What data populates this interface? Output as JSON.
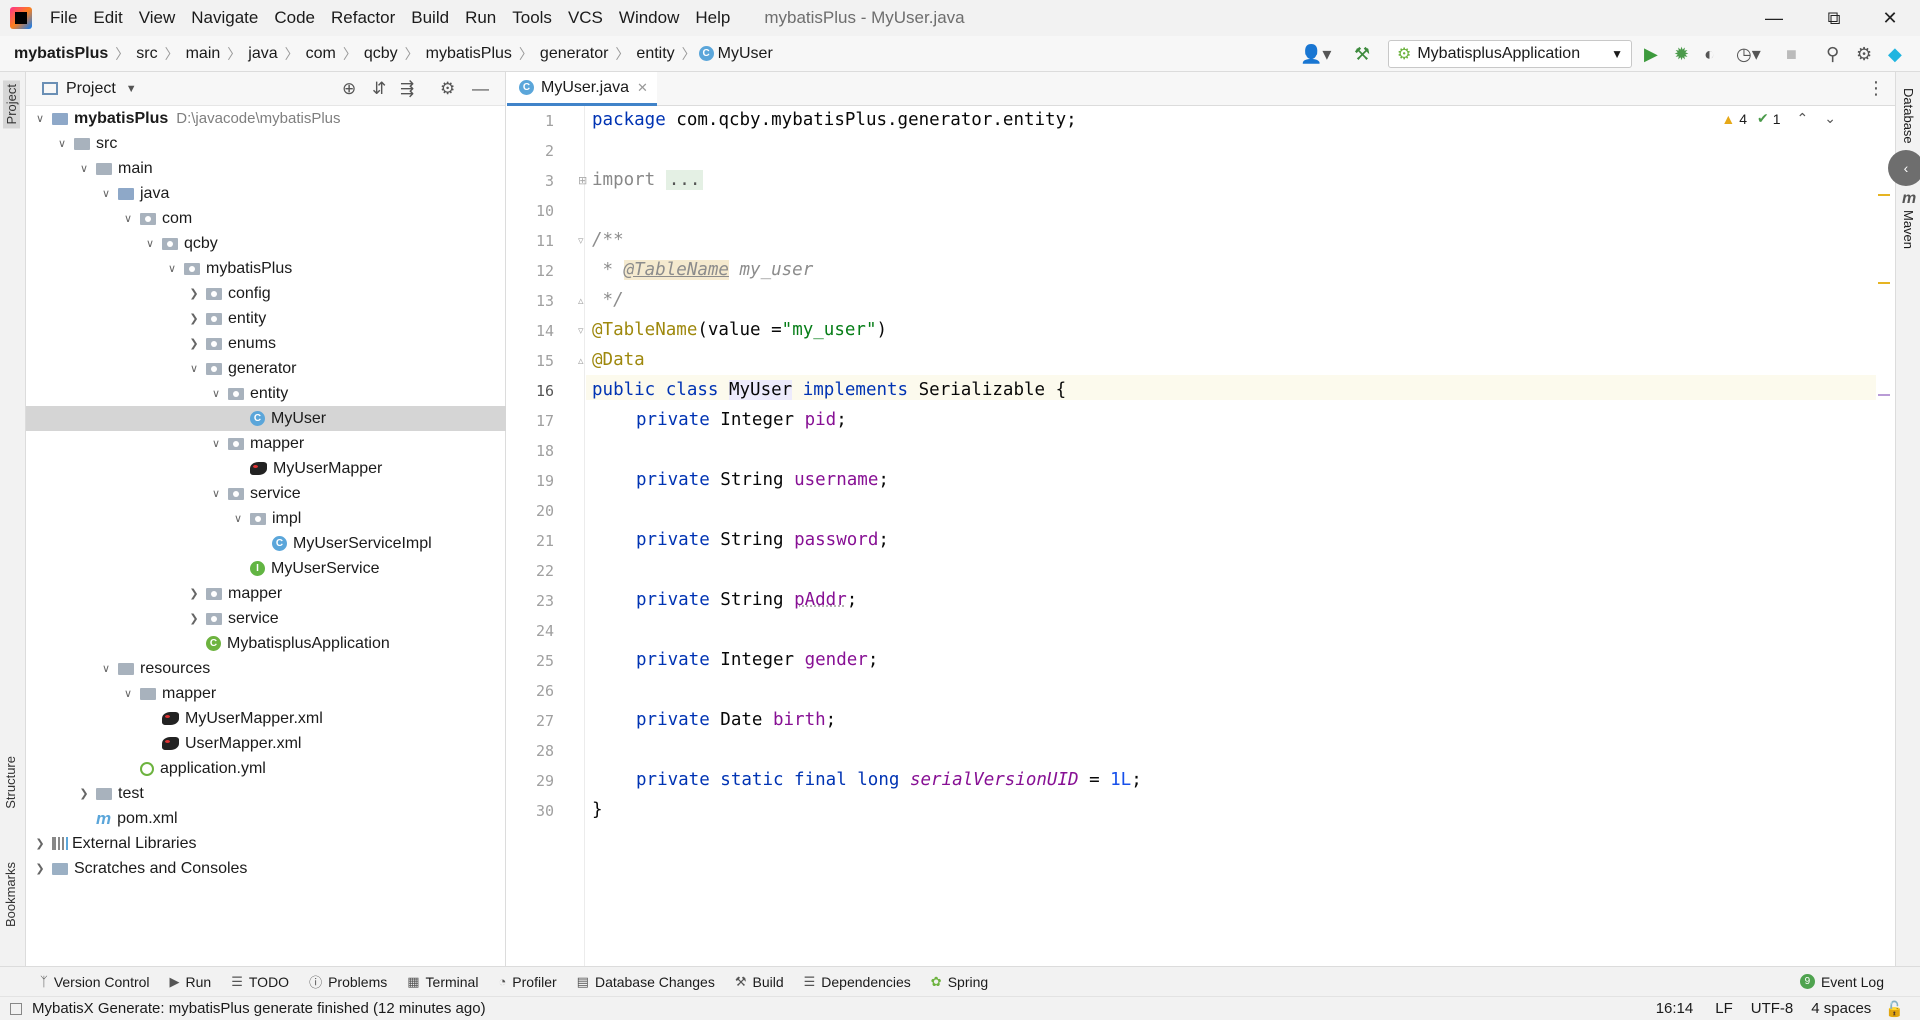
{
  "menu": [
    "File",
    "Edit",
    "View",
    "Navigate",
    "Code",
    "Refactor",
    "Build",
    "Run",
    "Tools",
    "VCS",
    "Window",
    "Help"
  ],
  "window_title": "mybatisPlus - MyUser.java",
  "breadcrumbs": [
    "mybatisPlus",
    "src",
    "main",
    "java",
    "com",
    "qcby",
    "mybatisPlus",
    "generator",
    "entity",
    "MyUser"
  ],
  "run_config": "MybatisplusApplication",
  "project_panel": {
    "title": "Project",
    "root_name": "mybatisPlus",
    "root_path": "D:\\javacode\\mybatisPlus",
    "nodes": [
      {
        "label": "src"
      },
      {
        "label": "main"
      },
      {
        "label": "java"
      },
      {
        "label": "com"
      },
      {
        "label": "qcby"
      },
      {
        "label": "mybatisPlus"
      },
      {
        "label": "config"
      },
      {
        "label": "entity"
      },
      {
        "label": "enums"
      },
      {
        "label": "generator"
      },
      {
        "label": "entity"
      },
      {
        "label": "MyUser"
      },
      {
        "label": "mapper"
      },
      {
        "label": "MyUserMapper"
      },
      {
        "label": "service"
      },
      {
        "label": "impl"
      },
      {
        "label": "MyUserServiceImpl"
      },
      {
        "label": "MyUserService"
      },
      {
        "label": "mapper"
      },
      {
        "label": "service"
      },
      {
        "label": "MybatisplusApplication"
      },
      {
        "label": "resources"
      },
      {
        "label": "mapper"
      },
      {
        "label": "MyUserMapper.xml"
      },
      {
        "label": "UserMapper.xml"
      },
      {
        "label": "application.yml"
      },
      {
        "label": "test"
      },
      {
        "label": "pom.xml"
      },
      {
        "label": "External Libraries"
      },
      {
        "label": "Scratches and Consoles"
      }
    ]
  },
  "left_stripe": {
    "project": "Project",
    "structure": "Structure",
    "bookmarks": "Bookmarks"
  },
  "right_stripe": {
    "database": "Database",
    "maven": "Maven"
  },
  "editor": {
    "tab_label": "MyUser.java",
    "inspections": {
      "warnings": "4",
      "weak": "1"
    },
    "line_numbers": [
      "1",
      "2",
      "3",
      "10",
      "11",
      "12",
      "13",
      "14",
      "15",
      "16",
      "17",
      "18",
      "19",
      "20",
      "21",
      "22",
      "23",
      "24",
      "25",
      "26",
      "27",
      "28",
      "29",
      "30"
    ],
    "code": {
      "package_kw": "package",
      "package_name": " com.qcby.mybatisPlus.generator.entity;",
      "import_kw": "import",
      "import_fold": "...",
      "doc_open": "/**",
      "doc_star": " * ",
      "doc_tag": "@TableName",
      "doc_text": " my_user",
      "doc_close": " */",
      "ann1": "@TableName",
      "ann1_args_a": "(value =",
      "ann1_args_str": "\"my_user\"",
      "ann1_args_b": ")",
      "ann2": "@Data",
      "class_kw": "public class ",
      "class_name": "MyUser",
      "impl_kw": " implements ",
      "impl_name": "Serializable {",
      "private_kw": "private",
      "f1_type": " Integer ",
      "f1_name": "pid",
      "semi": ";",
      "f2_type": " String ",
      "f2_name": "username",
      "f3_type": " String ",
      "f3_name": "password",
      "f4_type": " String ",
      "f4_name": "pAddr",
      "f5_type": " Integer ",
      "f5_name": "gender",
      "f6_type": " Date ",
      "f6_name": "birth",
      "f7_kw": " static final long ",
      "f7_name": "serialVersionUID",
      "f7_eq": " = ",
      "f7_val": "1L",
      "close": "}"
    }
  },
  "bottom_tools": [
    "Version Control",
    "Run",
    "TODO",
    "Problems",
    "Terminal",
    "Profiler",
    "Database Changes",
    "Build",
    "Dependencies",
    "Spring"
  ],
  "event_log": {
    "badge": "9",
    "label": "Event Log"
  },
  "status": {
    "message": "MybatisX Generate: mybatisPlus generate finished (12 minutes ago)",
    "position": "16:14",
    "line_sep": "LF",
    "encoding": "UTF-8",
    "indent": "4 spaces"
  }
}
